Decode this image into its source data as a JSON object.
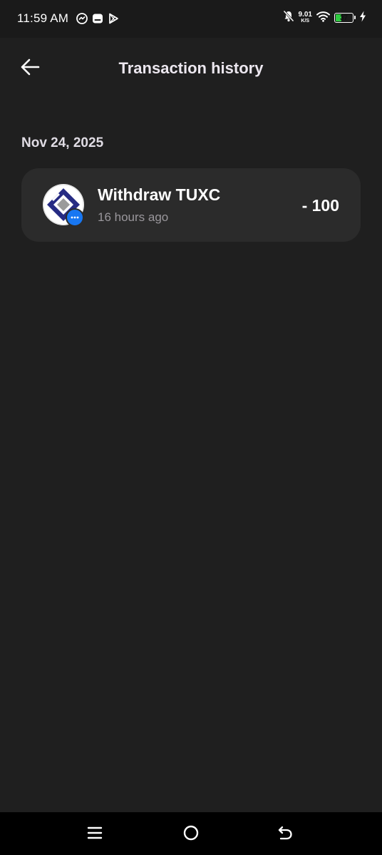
{
  "status_bar": {
    "time": "11:59 AM",
    "net_speed_value": "9.01",
    "net_speed_unit": "K/S",
    "battery_level": "37",
    "battery_fraction": 0.37,
    "battery_color": "#2ecc40",
    "left_icons": [
      "messenger-icon",
      "message-app-icon",
      "play-store-icon"
    ],
    "right_icons": [
      "bell-muted-icon",
      "wifi-icon",
      "battery-icon",
      "charging-bolt-icon"
    ]
  },
  "header": {
    "title": "Transaction history",
    "back_icon": "arrow-left-icon"
  },
  "sections": [
    {
      "date": "Nov 24, 2025",
      "transactions": [
        {
          "title": "Withdraw TUXC",
          "time": "16 hours ago",
          "amount": "- 100",
          "logo_icon": "tuxc-logo-icon",
          "badge_icon": "messenger-badge-icon",
          "badge_color": "#1877f2"
        }
      ]
    }
  ],
  "navigation_bar": {
    "buttons": [
      "menu-icon",
      "home-circle-icon",
      "back-return-icon"
    ]
  },
  "colors": {
    "background": "#1f1f1f",
    "card": "#2b2b2b",
    "title_text": "#ece7ef",
    "secondary_text": "#9a979c"
  }
}
